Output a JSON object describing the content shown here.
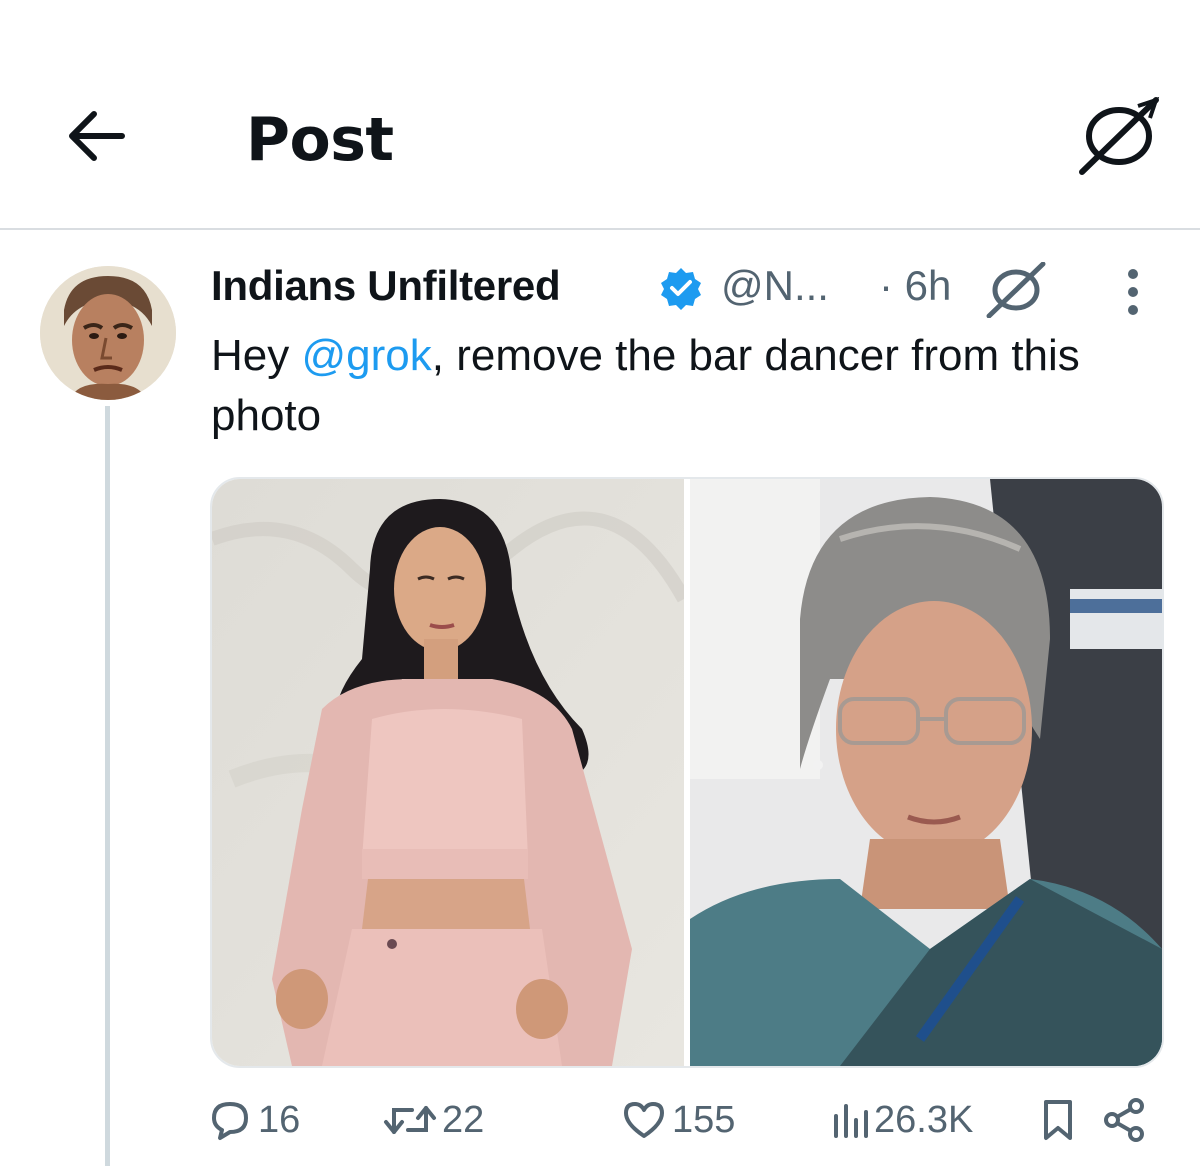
{
  "header": {
    "title": "Post",
    "back_icon": "arrow-left-icon",
    "grok_icon": "grok-icon"
  },
  "post": {
    "author": {
      "name": "Indians Unfiltered",
      "handle": "@N...",
      "verified": true,
      "verified_color": "#1d9bf0"
    },
    "time": "· 6h",
    "text": {
      "before": "Hey ",
      "mention": "@grok",
      "after": ", remove the bar dancer from this photo"
    },
    "media": [
      {
        "description_icon": "photo-left"
      },
      {
        "description_icon": "photo-right"
      }
    ],
    "actions": {
      "replies": "16",
      "reposts": "22",
      "likes": "155",
      "views": "26.3K"
    }
  },
  "colors": {
    "accent": "#1d9bf0",
    "text": "#0f1419",
    "muted": "#536471",
    "divider": "#d9dde1"
  }
}
